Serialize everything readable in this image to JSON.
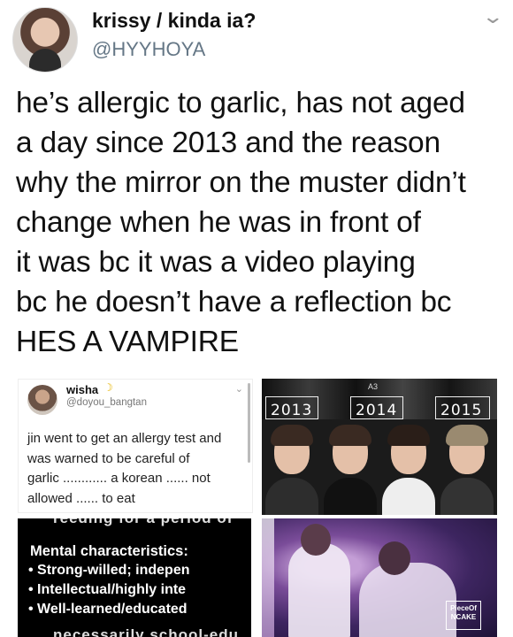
{
  "tweet": {
    "display_name": "krissy / kinda ia?",
    "handle": "@HYYHOYA",
    "text": "he’s allergic to garlic, has not aged\na day since 2013 and the reason\nwhy the mirror on the muster didn’t\nchange when he was in front of\nit was bc it was a video playing\nbc he doesn’t have a reflection bc\nHES A VAMPIRE"
  },
  "embedded_tweet": {
    "name": "wisha",
    "emoji": "☽",
    "handle": "@doyou_bangtan",
    "text": "jin went to get an allergy test and\nwas warned to be careful of\ngarlic ............ a korean ...... not\nallowed ...... to eat"
  },
  "photo_comparison": {
    "years": [
      "2013",
      "2014",
      "2015"
    ],
    "badge": "A3"
  },
  "mental_panel": {
    "cut_text_top": "reeding for a period of",
    "title": "Mental characteristics:",
    "items": [
      "Strong-willed; indepen",
      "Intellectual/highly inte",
      "Well-learned/educated"
    ],
    "cut_text_bottom": "necessarily school-edu"
  },
  "stage_photo": {
    "watermark": "PieceOf\nNCAKE"
  }
}
